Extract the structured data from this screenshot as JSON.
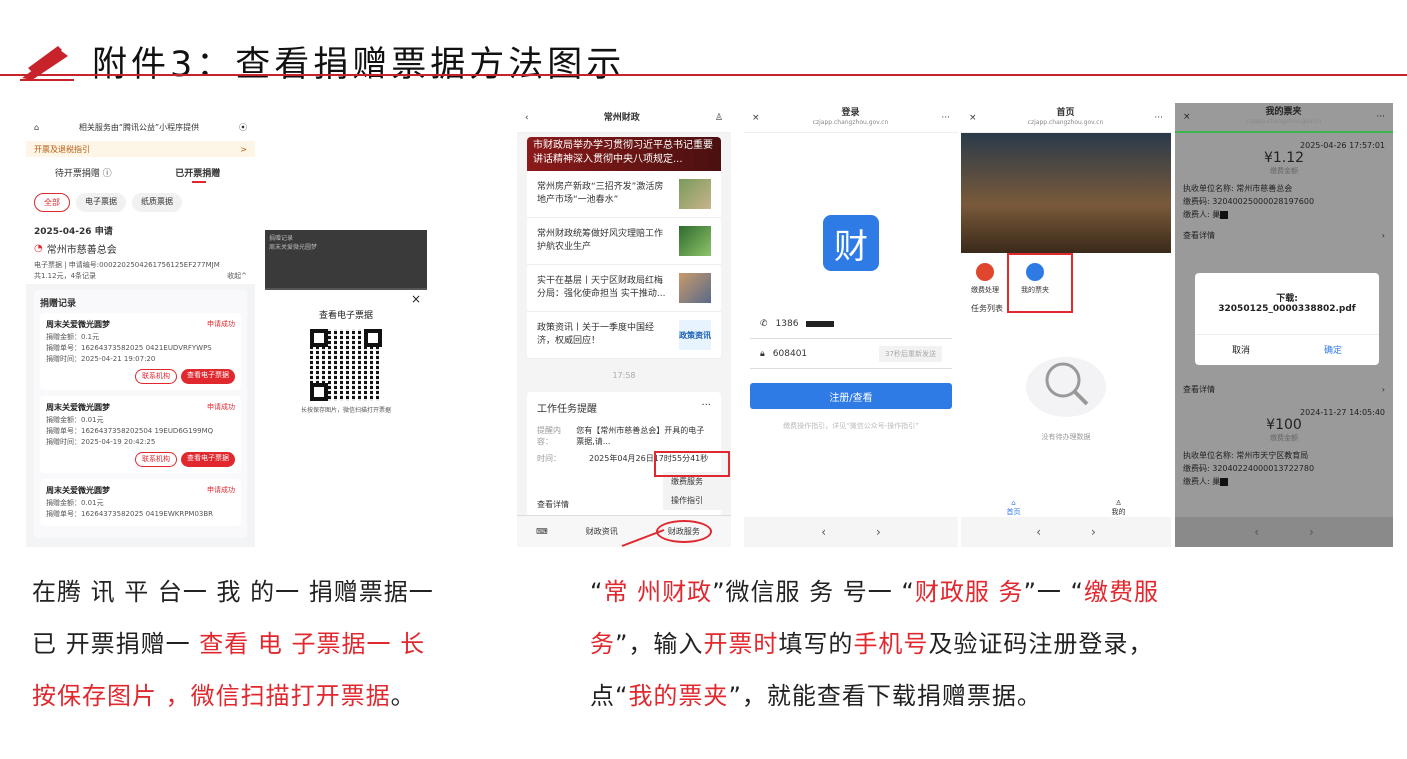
{
  "header": {
    "title": "附件3：查看捐赠票据方法图示"
  },
  "s1": {
    "top_title": "相关服务由“腾讯公益”小程序提供",
    "notice": "开票及退税指引",
    "notice_arrow": ">",
    "tabs": [
      "待开票捐赠 ⓘ",
      "已开票捐赠"
    ],
    "chips": [
      "全部",
      "电子票据",
      "纸质票据"
    ],
    "date": "2025-04-26 申请",
    "org": "常州市慈善总会",
    "meta1": "电子票据 | 申请编号:00022025042617561​25EF277MJM",
    "meta2": "共1.12元，4条记录",
    "collapse": "收起^",
    "records_title": "捐赠记录",
    "records": [
      {
        "name": "周末关爱微光圆梦",
        "status": "申请成功",
        "amount": "捐赠金额：0.1元",
        "no": "捐赠单号：16264373582025 0421EUDVRFYWPS",
        "time": "捐赠时间：2025-04-21 19:07:20",
        "b1": "联系机构",
        "b2": "查看电子票据"
      },
      {
        "name": "周末关爱微光圆梦",
        "status": "申请成功",
        "amount": "捐赠金额：0.01元",
        "no": "捐赠单号：1626437358202504 19EUD6G199MQ",
        "time": "捐赠时间：2025-04-19 20:42:25",
        "b1": "联系机构",
        "b2": "查看电子票据"
      },
      {
        "name": "周末关爱微光圆梦",
        "status": "申请成功",
        "amount": "捐赠金额：0.01元",
        "no": "捐赠单号：16264373582025 0419EWKRPM03BR",
        "time": "",
        "b1": "",
        "b2": ""
      }
    ]
  },
  "s2": {
    "dark_title": "捐赠记录",
    "dark_line": "周末关爱微光圆梦",
    "popup_title": "查看电子票据",
    "popup_close": "×",
    "caption": "长按保存图片，微信扫描打开票据"
  },
  "p1": {
    "title": "常州财政",
    "banner": "市财政局举办学习贯彻习近平总书记重要讲话精神深入贯彻中央八项规定...",
    "news": [
      "常州房产新政“三招齐发”激活房地产市场“一池春水”",
      "常州财政统筹做好风灾理赔工作护航农业生产",
      "实干在基层丨天宁区财政局红梅分局：强化使命担当 实干推动...",
      "政策资讯丨关于一季度中国经济，权威回应！"
    ],
    "badge": "政策资讯",
    "time": "17:58",
    "card_title": "工作任务提醒",
    "remind_label": "提醒内容：",
    "remind_text": "您有【常州市慈善总会】开具的电子票据,请...",
    "time_label": "时间：",
    "time_text": "2025年04月26日17时55分41秒",
    "menu1": "缴费服务",
    "menu2": "操作指引",
    "detail": "查看详情",
    "bottom1": "财政资讯",
    "bottom2": "财政服务"
  },
  "p2": {
    "title": "登录",
    "url": "czjapp.changzhou.gov.cn",
    "logo": "财",
    "phone": "1386",
    "code": "608401",
    "resend": "37秒后重新发送",
    "submit": "注册/查看",
    "hint": "缴费操作指引，详见“微信公众号-操作指引”"
  },
  "p3": {
    "title": "首页",
    "url": "czjapp.changzhou.gov.cn",
    "icon1": "缴费处理",
    "icon2": "我的票夹",
    "tasks": "任务列表",
    "empty": "没有待办理数据",
    "nav1": "首页",
    "nav2": "我的"
  },
  "p4": {
    "title": "我的票夹",
    "url": "czjapp.changzhou.gov.cn",
    "date1": "2025-04-26 17:57:01",
    "amount1": "¥1.12",
    "label_amt": "缴费金额",
    "unit1": "执收单位名称: 常州市慈善总会",
    "code1": "缴费码: 32040025000028197600",
    "payer": "缴费人: 巢",
    "detail": "查看详情",
    "dl_title": "下载:",
    "dl_file": "32050125_0000338802.pdf",
    "cancel": "取消",
    "confirm": "确定",
    "date2": "2024-11-27 14:05:40",
    "amount2": "¥100",
    "unit2": "执收单位名称: 常州市天宁区教育局",
    "code2": "缴费码: 32040224000013722780"
  },
  "caption_left": [
    [
      {
        "t": "在腾 讯 平 台一 我 的一 捐赠票据一",
        "r": false
      }
    ],
    [
      {
        "t": "已 开票捐赠一 ",
        "r": false
      },
      {
        "t": "查看 电 子票据一 长",
        "r": true
      }
    ],
    [
      {
        "t": "按保存图片 ，微信扫描打开票据",
        "r": true
      },
      {
        "t": "。",
        "r": false
      }
    ]
  ],
  "caption_right": [
    [
      {
        "t": "“",
        "r": false
      },
      {
        "t": "常 州财政",
        "r": true
      },
      {
        "t": "”微信服 务 号一 “",
        "r": false
      },
      {
        "t": "财政服 务",
        "r": true
      },
      {
        "t": "”一 “",
        "r": false
      },
      {
        "t": "缴费服",
        "r": true
      }
    ],
    [
      {
        "t": "务",
        "r": true
      },
      {
        "t": "”，输入",
        "r": false
      },
      {
        "t": "开票时",
        "r": true
      },
      {
        "t": "填写的",
        "r": false
      },
      {
        "t": "手机号",
        "r": true
      },
      {
        "t": "及验证码注册登录，",
        "r": false
      }
    ],
    [
      {
        "t": "点“",
        "r": false
      },
      {
        "t": "我的票夹",
        "r": true
      },
      {
        "t": "”，就能查看下载捐赠票据。",
        "r": false
      }
    ]
  ]
}
